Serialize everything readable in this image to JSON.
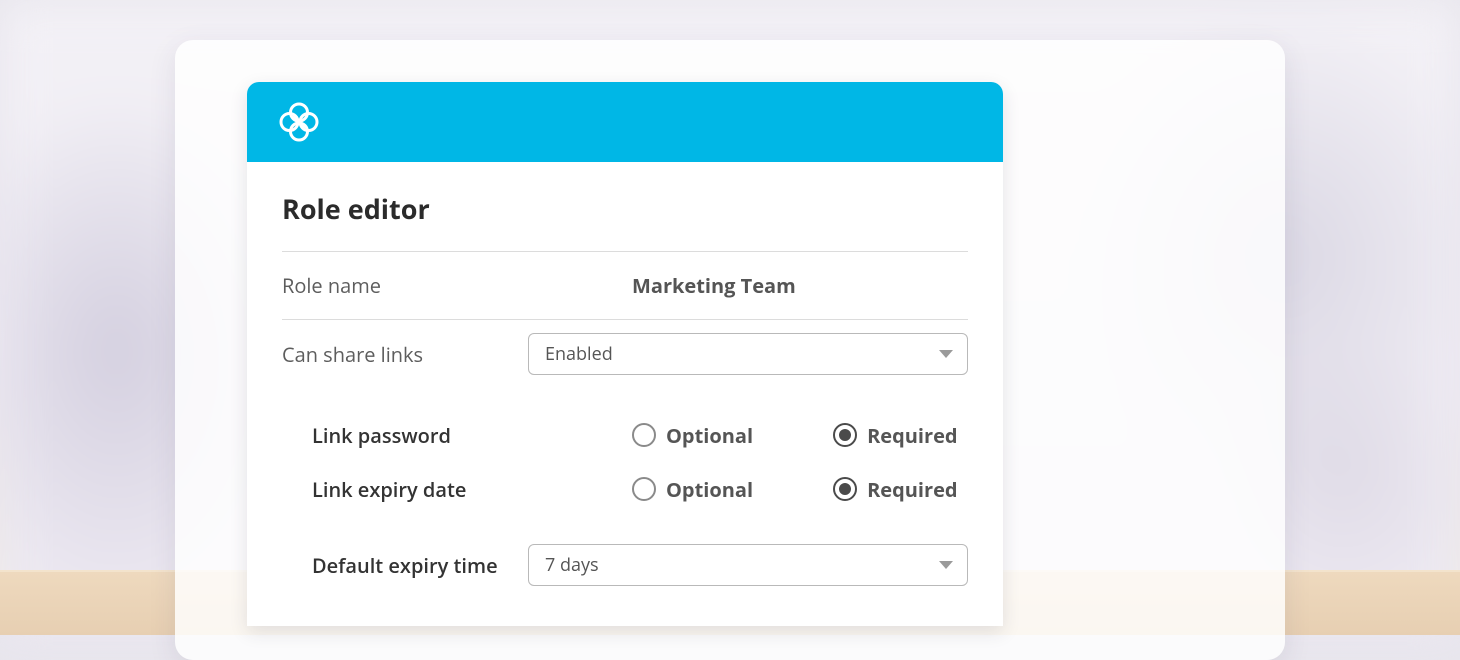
{
  "panel": {
    "title": "Role editor",
    "role_name": {
      "label": "Role name",
      "value": "Marketing Team"
    },
    "can_share": {
      "label": "Can share links",
      "selected": "Enabled"
    },
    "link_password": {
      "label": "Link password",
      "options": {
        "optional": "Optional",
        "required": "Required"
      },
      "selected": "required"
    },
    "link_expiry": {
      "label": "Link expiry date",
      "options": {
        "optional": "Optional",
        "required": "Required"
      },
      "selected": "required"
    },
    "default_expiry": {
      "label": "Default expiry time",
      "selected": "7 days"
    }
  }
}
